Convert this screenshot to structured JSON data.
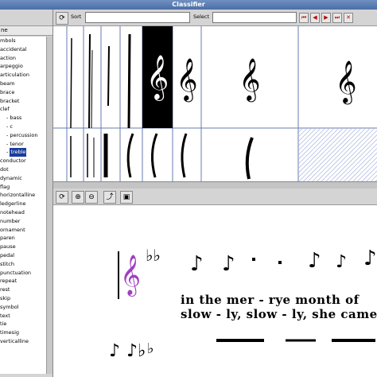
{
  "window": {
    "title": "Classifier"
  },
  "left": {
    "header_partial": "ne",
    "tree": [
      "mbols",
      "accidental",
      "action",
      "arpeggio",
      "articulation",
      "beam",
      "brace",
      "bracket",
      "clef",
      "bass",
      "c",
      "percussion",
      "tenor",
      "treble",
      "conductor",
      "dot",
      "dynamic",
      "flag",
      "horizontalline",
      "ledgerline",
      "notehead",
      "number",
      "ornament",
      "paren",
      "pause",
      "pedal",
      "stitch",
      "punctuation",
      "repeat",
      "rest",
      "skip",
      "symbol",
      "text",
      "tie",
      "timesig",
      "verticalline"
    ],
    "selected": "treble"
  },
  "toolbar": {
    "sort_label": "Sort",
    "select_label": "Select",
    "refresh_icon": "refresh-icon"
  },
  "view_toolbar": {
    "icons": [
      "refresh-icon",
      "zoom-in-icon",
      "zoom-out-icon",
      "export-icon",
      "image-icon"
    ]
  },
  "score": {
    "lyric_line1": "in  the  mer - rye  month of",
    "lyric_line2": "slow - ly,  slow  -  ly,  she  came",
    "clef_color": "#a040c0"
  },
  "colors": {
    "title_bar": "#4a6ea6",
    "selection": "#1a3c9c"
  }
}
